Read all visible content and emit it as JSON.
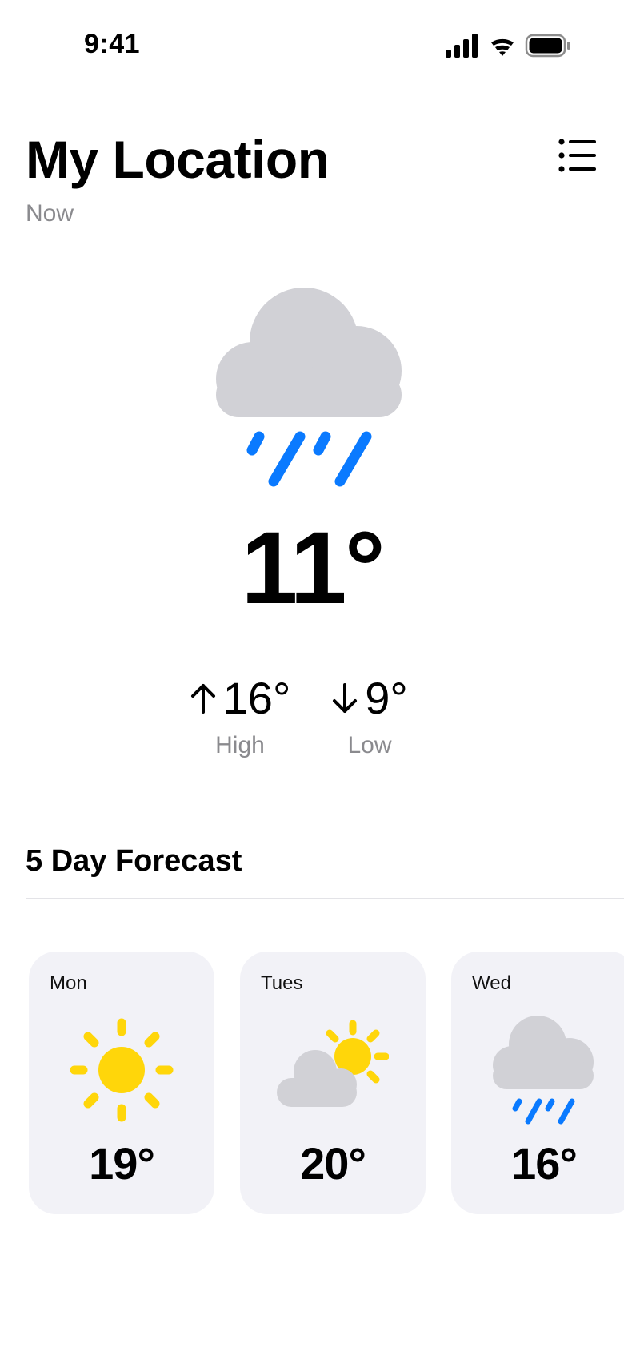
{
  "status_bar": {
    "time": "9:41",
    "icons": [
      "cellular-signal-icon",
      "wifi-icon",
      "battery-icon"
    ]
  },
  "header": {
    "title": "My Location",
    "subtitle": "Now",
    "list_button_icon": "list-icon"
  },
  "current": {
    "icon": "rain-cloud-icon",
    "temperature": "11°",
    "high": {
      "icon": "arrow-up-icon",
      "value": "16°",
      "label": "High"
    },
    "low": {
      "icon": "arrow-down-icon",
      "value": "9°",
      "label": "Low"
    }
  },
  "forecast": {
    "title": "5 Day Forecast",
    "days": [
      {
        "day": "Mon",
        "icon": "sun-icon",
        "temp": "19°"
      },
      {
        "day": "Tues",
        "icon": "partly-cloudy-icon",
        "temp": "20°"
      },
      {
        "day": "Wed",
        "icon": "rain-cloud-icon",
        "temp": "16°"
      }
    ]
  },
  "colors": {
    "cloud": "#d1d1d6",
    "rain": "#0a7aff",
    "sun": "#ffd60a",
    "card_background": "#f2f2f7",
    "secondary_text": "#8a8a8e"
  }
}
